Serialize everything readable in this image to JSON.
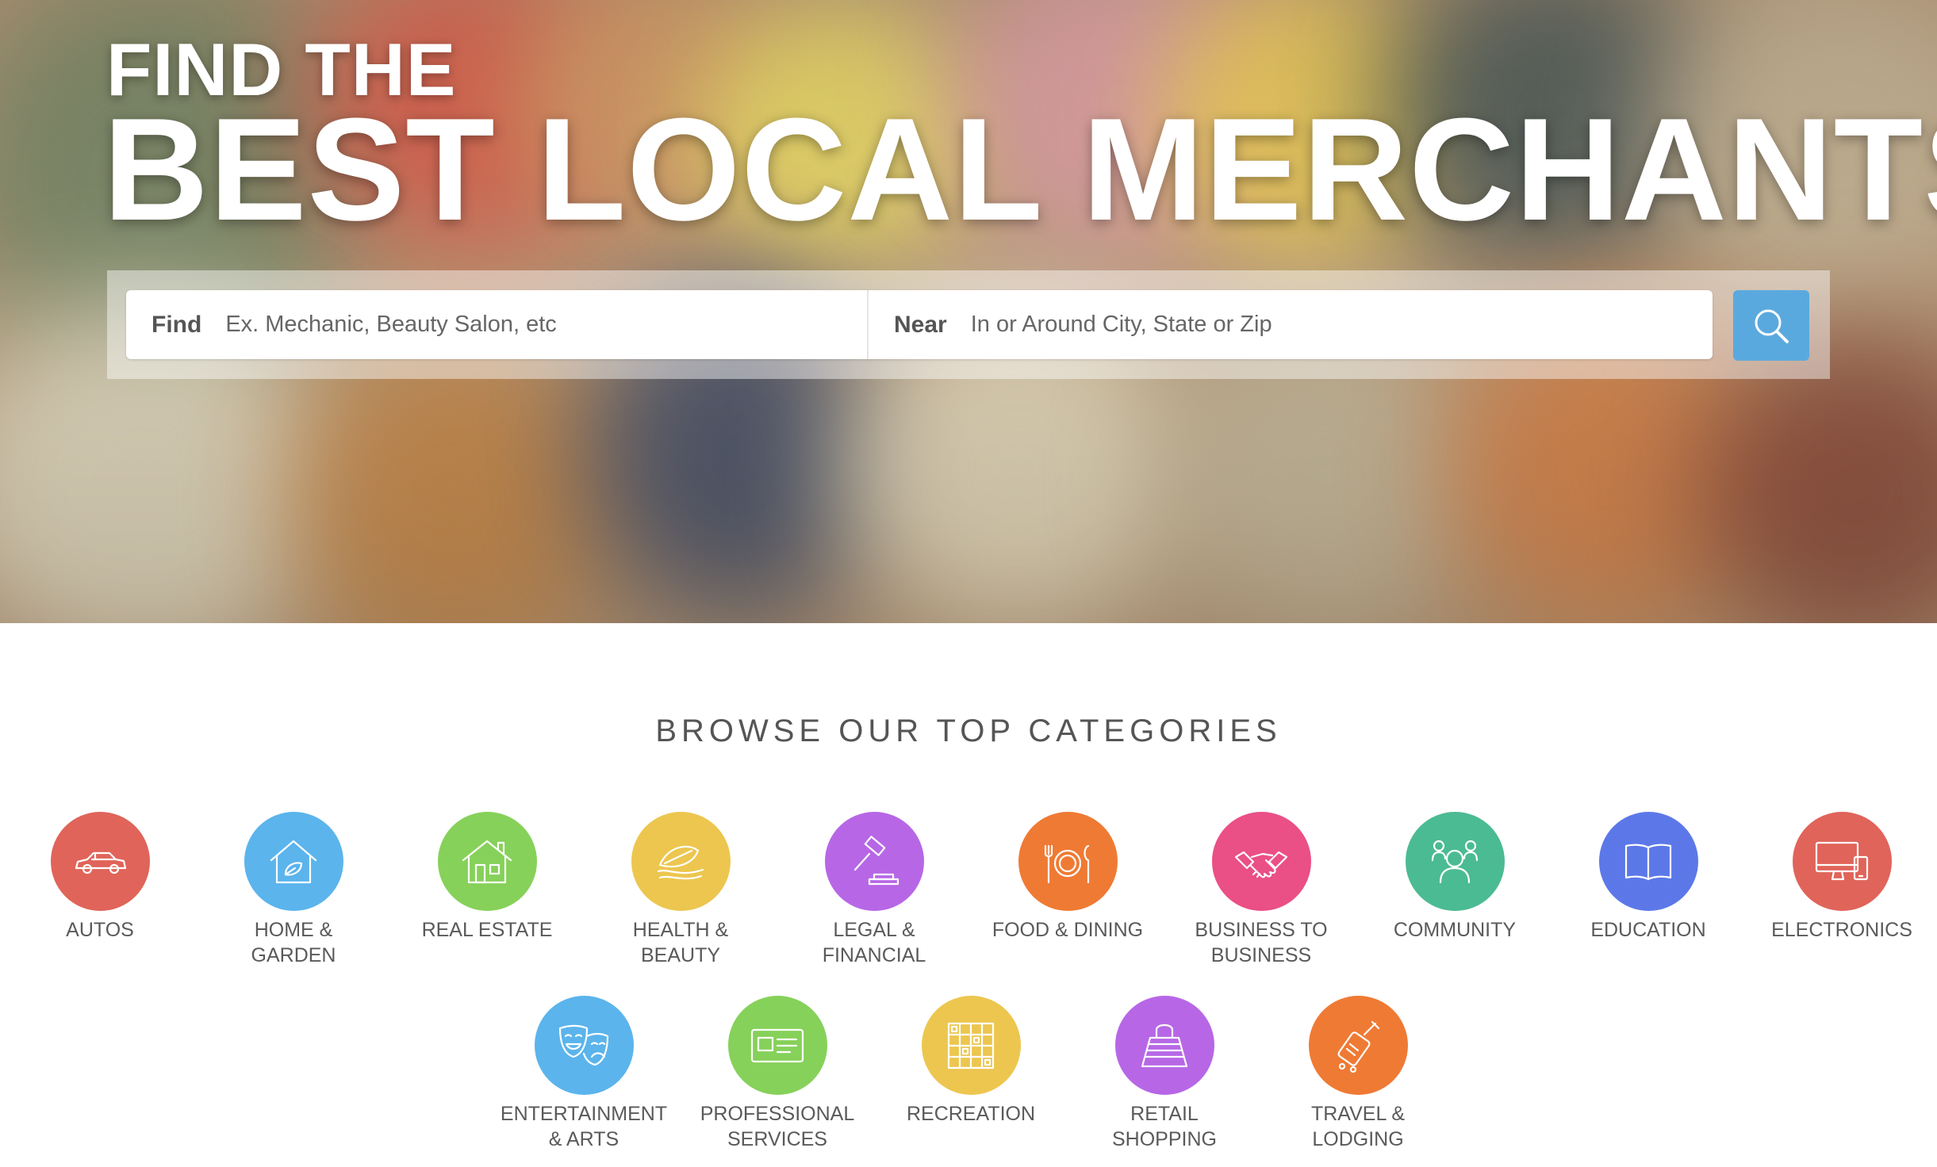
{
  "hero": {
    "title_small": "FIND THE",
    "title_big": "BEST LOCAL MERCHANTS"
  },
  "search": {
    "find_label": "Find",
    "find_placeholder": "Ex. Mechanic, Beauty Salon, etc",
    "near_label": "Near",
    "near_placeholder": "In or Around City, State or Zip",
    "button_icon": "search-icon",
    "button_color": "#5aa9de"
  },
  "browse": {
    "title": "BROWSE OUR TOP CATEGORIES"
  },
  "categories": [
    {
      "label": "AUTOS",
      "icon": "car-icon",
      "color": "#e0645a"
    },
    {
      "label": "HOME &\nGARDEN",
      "icon": "house-leaf-icon",
      "color": "#5bb4ec"
    },
    {
      "label": "REAL ESTATE",
      "icon": "house-icon",
      "color": "#86d15a"
    },
    {
      "label": "HEALTH &\nBEAUTY",
      "icon": "leaf-hand-icon",
      "color": "#ecc64f"
    },
    {
      "label": "LEGAL &\nFINANCIAL",
      "icon": "gavel-icon",
      "color": "#b767e6"
    },
    {
      "label": "FOOD & DINING",
      "icon": "plate-cutlery-icon",
      "color": "#ef7a34"
    },
    {
      "label": "BUSINESS TO\nBUSINESS",
      "icon": "handshake-icon",
      "color": "#ea4f86"
    },
    {
      "label": "COMMUNITY",
      "icon": "people-icon",
      "color": "#4bbb93"
    },
    {
      "label": "EDUCATION",
      "icon": "book-icon",
      "color": "#5c78e8"
    },
    {
      "label": "ELECTRONICS",
      "icon": "devices-icon",
      "color": "#e0645a"
    },
    {
      "label": "ENTERTAINMENT\n& ARTS",
      "icon": "theater-masks-icon",
      "color": "#5bb4ec"
    },
    {
      "label": "PROFESSIONAL\nSERVICES",
      "icon": "id-card-icon",
      "color": "#86d15a"
    },
    {
      "label": "RECREATION",
      "icon": "game-board-icon",
      "color": "#ecc64f"
    },
    {
      "label": "RETAIL\nSHOPPING",
      "icon": "shopping-bag-icon",
      "color": "#b767e6"
    },
    {
      "label": "TRAVEL &\nLODGING",
      "icon": "luggage-icon",
      "color": "#ef7a34"
    }
  ]
}
